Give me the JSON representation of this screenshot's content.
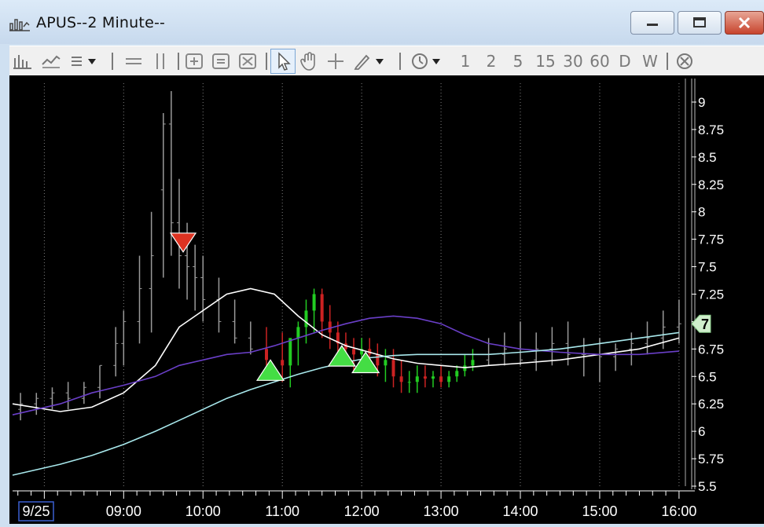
{
  "window": {
    "title": "APUS--2 Minute--"
  },
  "toolbar": {
    "icons": [
      "bar-chart-icon",
      "line-chart-icon",
      "chart-style-menu-icon",
      "horizontal-line-icon",
      "parallel-lines-icon",
      "zoom-in-icon",
      "zoom-fit-icon",
      "zoom-out-icon",
      "pointer-icon",
      "hand-pan-icon",
      "crosshair-icon",
      "pencil-draw-icon",
      "clock-menu-icon",
      "close-circle-icon"
    ],
    "periods": [
      "1",
      "2",
      "5",
      "15",
      "30",
      "60",
      "D",
      "W"
    ]
  },
  "colors": {
    "background": "#000000",
    "up_candle": "#22cc22",
    "down_candle": "#cc2222",
    "neutral_bar": "#9a9a9a",
    "ma_white": "#ffffff",
    "ma_purple": "#6a3fc8",
    "ma_cyan": "#a8e8ec",
    "buy_marker": "#44dd44",
    "sell_marker": "#dd3322",
    "axis_text": "#ffffff",
    "grid": "#808080"
  },
  "chart_data": {
    "type": "line",
    "symbol": "APUS",
    "interval": "2 Minute",
    "y_ticks": [
      "9",
      "8.75",
      "8.5",
      "8.25",
      "8",
      "7.75",
      "7.5",
      "7.25",
      "7",
      "6.75",
      "6.5",
      "6.25",
      "6",
      "5.75",
      "5.5"
    ],
    "ylim": [
      5.5,
      9.1
    ],
    "x_ticks": [
      "9/25",
      "09:00",
      "10:00",
      "11:00",
      "12:00",
      "13:00",
      "14:00",
      "15:00",
      "16:00"
    ],
    "x_tick_hours": [
      8.0,
      9.0,
      10.0,
      11.0,
      12.0,
      13.0,
      14.0,
      15.0,
      16.0
    ],
    "xlim": [
      7.6,
      16.1
    ],
    "last_price_label": "7",
    "last_price": 6.98,
    "series": [
      {
        "name": "",
        "color": "#ffffff",
        "x": [
          7.6,
          8.2,
          8.6,
          9.0,
          9.4,
          9.7,
          10.0,
          10.3,
          10.6,
          10.9,
          11.2,
          11.5,
          11.8,
          12.1,
          12.4,
          12.7,
          13.0,
          13.3,
          13.6,
          14.0,
          14.5,
          15.0,
          15.5,
          16.0
        ],
        "y": [
          6.25,
          6.18,
          6.22,
          6.35,
          6.6,
          6.95,
          7.1,
          7.25,
          7.3,
          7.25,
          7.05,
          6.88,
          6.78,
          6.72,
          6.66,
          6.62,
          6.6,
          6.58,
          6.6,
          6.62,
          6.65,
          6.7,
          6.75,
          6.85
        ]
      },
      {
        "name": "",
        "color": "#6a3fc8",
        "x": [
          7.6,
          8.2,
          8.6,
          9.0,
          9.4,
          9.7,
          10.0,
          10.3,
          10.6,
          10.9,
          11.2,
          11.5,
          11.8,
          12.1,
          12.4,
          12.7,
          13.0,
          13.3,
          13.6,
          14.0,
          14.5,
          15.0,
          15.5,
          16.0
        ],
        "y": [
          6.15,
          6.25,
          6.35,
          6.42,
          6.5,
          6.6,
          6.65,
          6.7,
          6.72,
          6.78,
          6.85,
          6.92,
          6.98,
          7.03,
          7.05,
          7.03,
          6.98,
          6.88,
          6.8,
          6.75,
          6.72,
          6.7,
          6.7,
          6.73
        ]
      },
      {
        "name": "",
        "color": "#a8e8ec",
        "x": [
          7.6,
          8.2,
          8.6,
          9.0,
          9.4,
          9.7,
          10.0,
          10.3,
          10.6,
          10.9,
          11.2,
          11.5,
          11.8,
          12.1,
          12.4,
          12.7,
          13.0,
          13.3,
          13.6,
          14.0,
          14.5,
          15.0,
          15.5,
          16.0
        ],
        "y": [
          5.6,
          5.7,
          5.78,
          5.88,
          6.0,
          6.1,
          6.2,
          6.3,
          6.38,
          6.45,
          6.52,
          6.58,
          6.63,
          6.67,
          6.69,
          6.7,
          6.7,
          6.7,
          6.7,
          6.72,
          6.75,
          6.8,
          6.85,
          6.9
        ]
      }
    ],
    "bars": {
      "x": [
        7.7,
        7.9,
        8.1,
        8.3,
        8.5,
        8.7,
        8.9,
        9.0,
        9.2,
        9.35,
        9.5,
        9.6,
        9.7,
        9.8,
        9.9,
        10.0,
        10.2,
        10.4,
        10.6,
        10.8,
        11.0,
        11.1,
        11.2,
        11.3,
        11.4,
        11.5,
        11.6,
        11.7,
        11.8,
        11.9,
        12.0,
        12.1,
        12.2,
        12.3,
        12.4,
        12.5,
        12.6,
        12.7,
        12.8,
        12.9,
        13.0,
        13.1,
        13.2,
        13.3,
        13.4,
        13.6,
        13.8,
        14.0,
        14.2,
        14.4,
        14.6,
        14.8,
        15.0,
        15.2,
        15.4,
        15.6,
        15.8,
        16.0
      ],
      "open": [
        6.2,
        6.25,
        6.3,
        6.35,
        6.3,
        6.4,
        6.6,
        6.8,
        7.0,
        7.3,
        8.2,
        8.8,
        7.9,
        7.6,
        7.5,
        7.4,
        7.2,
        7.0,
        6.85,
        6.75,
        6.65,
        6.6,
        6.85,
        6.95,
        7.1,
        7.25,
        7.0,
        6.9,
        6.8,
        6.75,
        6.7,
        6.75,
        6.7,
        6.6,
        6.65,
        6.5,
        6.45,
        6.45,
        6.5,
        6.48,
        6.5,
        6.45,
        6.5,
        6.55,
        6.6,
        6.65,
        6.7,
        6.75,
        6.65,
        6.75,
        6.8,
        6.7,
        6.7,
        6.68,
        6.75,
        6.8,
        6.85,
        6.95
      ],
      "high": [
        6.35,
        6.35,
        6.4,
        6.45,
        6.45,
        6.6,
        6.95,
        7.1,
        7.6,
        8.0,
        8.9,
        9.1,
        8.3,
        7.9,
        7.7,
        7.6,
        7.4,
        7.2,
        7.0,
        6.95,
        6.9,
        6.8,
        7.0,
        7.2,
        7.3,
        7.3,
        7.15,
        7.0,
        6.9,
        6.85,
        6.85,
        6.85,
        6.8,
        6.75,
        6.75,
        6.65,
        6.55,
        6.6,
        6.6,
        6.55,
        6.6,
        6.55,
        6.6,
        6.7,
        6.75,
        6.85,
        6.9,
        7.0,
        6.9,
        6.95,
        7.0,
        6.85,
        6.85,
        6.8,
        6.9,
        7.0,
        7.1,
        7.2
      ],
      "low": [
        6.1,
        6.15,
        6.2,
        6.2,
        6.25,
        6.3,
        6.5,
        6.6,
        6.8,
        6.9,
        7.4,
        7.6,
        7.3,
        7.2,
        7.1,
        7.0,
        6.9,
        6.8,
        6.7,
        6.6,
        6.45,
        6.4,
        6.6,
        6.8,
        6.9,
        6.85,
        6.75,
        6.65,
        6.6,
        6.55,
        6.6,
        6.55,
        6.5,
        6.45,
        6.4,
        6.35,
        6.35,
        6.35,
        6.4,
        6.4,
        6.4,
        6.4,
        6.45,
        6.5,
        6.55,
        6.6,
        6.6,
        6.6,
        6.55,
        6.6,
        6.6,
        6.5,
        6.45,
        6.55,
        6.6,
        6.7,
        6.75,
        6.8
      ],
      "close": [
        6.25,
        6.3,
        6.35,
        6.3,
        6.4,
        6.6,
        6.8,
        7.0,
        7.3,
        7.6,
        8.8,
        7.9,
        7.6,
        7.5,
        7.4,
        7.2,
        7.0,
        6.85,
        6.75,
        6.65,
        6.6,
        6.85,
        6.95,
        7.1,
        7.25,
        7.0,
        6.9,
        6.8,
        6.75,
        6.7,
        6.75,
        6.7,
        6.6,
        6.65,
        6.5,
        6.45,
        6.45,
        6.5,
        6.48,
        6.5,
        6.45,
        6.5,
        6.55,
        6.6,
        6.65,
        6.7,
        6.75,
        6.65,
        6.75,
        6.8,
        6.7,
        6.7,
        6.68,
        6.75,
        6.8,
        6.85,
        6.95,
        6.98
      ],
      "colored_from": 10.75
    },
    "markers": [
      {
        "type": "sell",
        "x": 9.75,
        "y": 7.72
      },
      {
        "type": "buy",
        "x": 10.85,
        "y": 6.55
      },
      {
        "type": "buy",
        "x": 11.75,
        "y": 6.68
      },
      {
        "type": "buy",
        "x": 12.05,
        "y": 6.62
      }
    ],
    "grid": true
  }
}
